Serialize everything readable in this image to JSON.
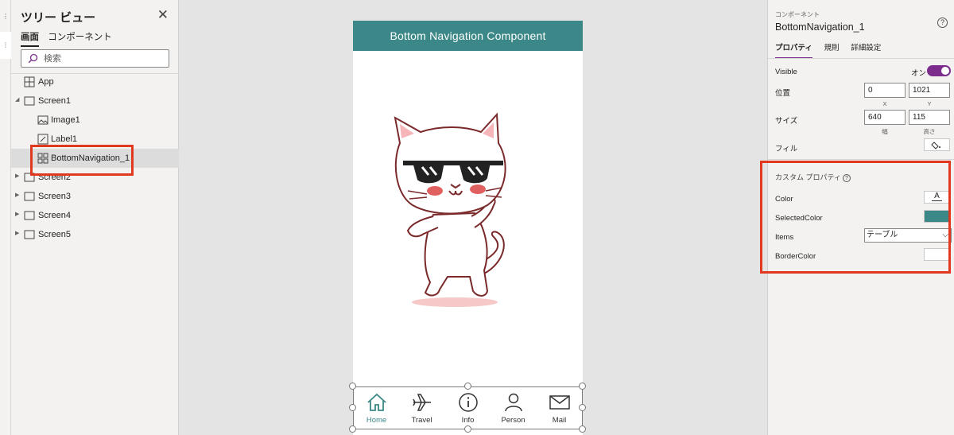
{
  "tree": {
    "title": "ツリー ビュー",
    "tabs": [
      "画面",
      "コンポーネント"
    ],
    "search_placeholder": "検索",
    "nodes": [
      {
        "label": "App",
        "icon": "app-icon"
      },
      {
        "label": "Screen1",
        "icon": "screen-icon",
        "expanded": true
      },
      {
        "label": "Image1",
        "icon": "image-icon"
      },
      {
        "label": "Label1",
        "icon": "label-icon"
      },
      {
        "label": "BottomNavigation_1",
        "icon": "component-icon",
        "selected": true
      },
      {
        "label": "Screen2",
        "icon": "screen-icon"
      },
      {
        "label": "Screen3",
        "icon": "screen-icon"
      },
      {
        "label": "Screen4",
        "icon": "screen-icon"
      },
      {
        "label": "Screen5",
        "icon": "screen-icon"
      }
    ]
  },
  "canvas": {
    "header_title": "Bottom Navigation Component",
    "header_color": "#3c8787",
    "nav_items": [
      {
        "label": "Home",
        "icon": "home-icon",
        "active": true
      },
      {
        "label": "Travel",
        "icon": "airplane-icon"
      },
      {
        "label": "Info",
        "icon": "info-icon"
      },
      {
        "label": "Person",
        "icon": "person-icon"
      },
      {
        "label": "Mail",
        "icon": "mail-icon"
      }
    ]
  },
  "props": {
    "category": "コンポーネント",
    "name": "BottomNavigation_1",
    "tabs": [
      "プロパティ",
      "規則",
      "詳細設定"
    ],
    "visible_label": "Visible",
    "visible_value": "オン",
    "position_label": "位置",
    "x_value": "0",
    "y_value": "1021",
    "x_sub": "X",
    "y_sub": "Y",
    "size_label": "サイズ",
    "width_value": "640",
    "height_value": "115",
    "width_sub": "幅",
    "height_sub": "高さ",
    "fill_label": "フィル",
    "custom_title": "カスタム プロパティ",
    "color_label": "Color",
    "color_glyph": "A",
    "selected_color_label": "SelectedColor",
    "selected_color": "#3c8787",
    "items_label": "Items",
    "items_value": "テーブル",
    "border_color_label": "BorderColor",
    "accent_color": "#7b2c8c"
  }
}
